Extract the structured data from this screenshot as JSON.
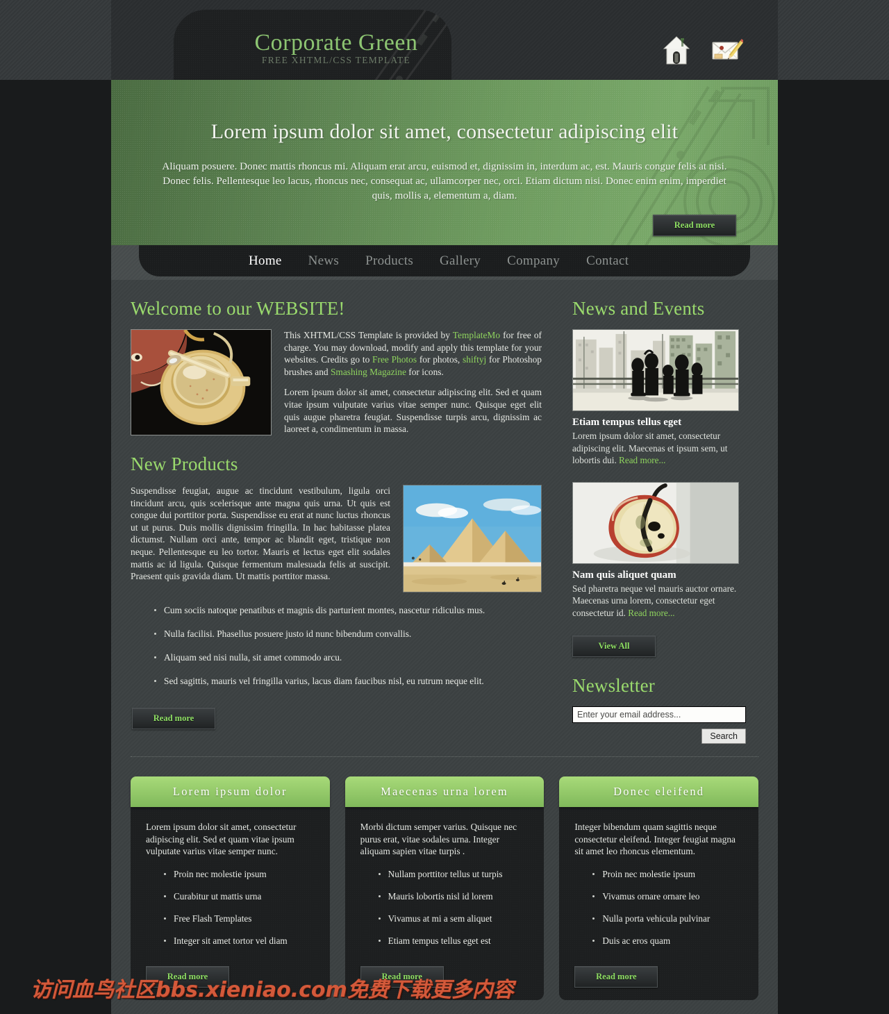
{
  "site": {
    "logo_title": "Corporate Green",
    "logo_subtitle": "FREE XHTML/CSS TEMPLATE",
    "accent_green": "#8fd45e",
    "heading_green": "#9ada6d",
    "banner_green": "#6d9a5e",
    "box_header_green": "#a7d978"
  },
  "header": {
    "icons": [
      {
        "name": "home-icon",
        "label": "Home"
      },
      {
        "name": "contact-envelope-icon",
        "label": "Contact"
      }
    ]
  },
  "banner": {
    "title": "Lorem ipsum dolor sit amet, consectetur adipiscing elit",
    "text": "Aliquam posuere. Donec mattis rhoncus mi. Aliquam erat arcu, euismod et, dignissim in, interdum ac, est. Mauris congue felis at nisi. Donec felis. Pellentesque leo lacus, rhoncus nec, consequat ac, ullamcorper nec, orci. Etiam dictum nisi. Donec enim enim, imperdiet quis, mollis a, elementum a, diam.",
    "read_more": "Read more"
  },
  "nav": {
    "items": [
      {
        "label": "Home",
        "active": true
      },
      {
        "label": "News",
        "active": false
      },
      {
        "label": "Products",
        "active": false
      },
      {
        "label": "Gallery",
        "active": false
      },
      {
        "label": "Company",
        "active": false
      },
      {
        "label": "Contact",
        "active": false
      }
    ]
  },
  "welcome": {
    "heading": "Welcome to our WEBSITE!",
    "image_alt": "coffee-cup-photo",
    "para1_a": "This XHTML/CSS Template is provided by ",
    "link1": "TemplateMo",
    "para1_b": " for free of charge. You may download, modify and apply this template for your websites. Credits go to ",
    "link2": "Free Photos",
    "para1_c": " for photos, ",
    "link3": "shiftyj",
    "para1_d": " for Photoshop brushes and ",
    "link4": "Smashing Magazine",
    "para1_e": " for icons.",
    "para2": "Lorem ipsum dolor sit amet, consectetur adipiscing elit. Sed et quam vitae ipsum vulputate varius vitae semper nunc. Quisque eget elit quis augue pharetra feugiat. Suspendisse turpis arcu, dignissim ac laoreet a, condimentum in massa."
  },
  "products": {
    "heading": "New Products",
    "image_alt": "pyramids-photo",
    "paragraph": "Suspendisse feugiat, augue ac tincidunt vestibulum, ligula orci tincidunt arcu, quis scelerisque ante magna quis urna. Ut quis est congue dui porttitor porta. Suspendisse eu erat at nunc luctus rhoncus ut ut purus. Duis mollis dignissim fringilla. In hac habitasse platea dictumst. Nullam orci ante, tempor ac blandit eget, tristique non neque. Pellentesque eu leo tortor. Mauris et lectus eget elit sodales mattis ac id ligula. Quisque fermentum malesuada felis at suscipit. Praesent quis gravida diam. Ut mattis porttitor massa.",
    "bullets": [
      "Cum sociis natoque penatibus et magnis dis parturient montes, nascetur ridiculus mus.",
      "Nulla facilisi. Phasellus posuere justo id nunc bibendum convallis.",
      "Aliquam sed nisi nulla, sit amet commodo arcu.",
      "Sed sagittis, mauris vel fringilla varius, lacus diam faucibus nisl, eu rutrum neque elit."
    ],
    "read_more": "Read more"
  },
  "news": {
    "heading": "News and Events",
    "items": [
      {
        "image_alt": "city-silhouette-photo",
        "title": "Etiam tempus tellus eget",
        "text": "Lorem ipsum dolor sit amet, consectetur adipiscing elit. Maecenas et ipsum sem, ut lobortis dui. ",
        "link": "Read more..."
      },
      {
        "image_alt": "apple-halved-photo",
        "title": "Nam quis aliquet quam",
        "text": "Sed pharetra neque vel mauris auctor ornare. Maecenas urna lorem, consectetur eget consectetur id. ",
        "link": "Read more..."
      }
    ],
    "view_all": "View All"
  },
  "newsletter": {
    "heading": "Newsletter",
    "input_value": "Enter your email address...",
    "input_placeholder": "Enter your email address...",
    "button": "Search"
  },
  "boxes": [
    {
      "title": "Lorem ipsum dolor",
      "text": "Lorem ipsum dolor sit amet, consectetur adipiscing elit. Sed et quam vitae ipsum vulputate varius vitae semper nunc.",
      "bullets": [
        "Proin nec molestie ipsum",
        "Curabitur ut mattis urna",
        "Free Flash Templates",
        "Integer sit amet tortor vel diam"
      ],
      "read_more": "Read more"
    },
    {
      "title": "Maecenas urna lorem",
      "text": "Morbi dictum semper varius. Quisque nec purus erat, vitae sodales urna. Integer aliquam sapien vitae turpis .",
      "bullets": [
        "Nullam porttitor tellus ut turpis",
        "Mauris lobortis nisl id lorem",
        "Vivamus at mi a sem aliquet",
        "Etiam tempus tellus eget est"
      ],
      "read_more": "Read more"
    },
    {
      "title": "Donec eleifend",
      "text": "Integer bibendum quam sagittis neque consectetur eleifend. Integer feugiat magna sit amet leo rhoncus elementum.",
      "bullets": [
        "Proin nec molestie ipsum",
        "Vivamus ornare ornare leo",
        "Nulla porta vehicula pulvinar",
        "Duis ac eros quam"
      ],
      "read_more": "Read more"
    }
  ],
  "watermark": {
    "text": "访问血鸟社区bbs.xieniao.com免费下载更多内容"
  }
}
